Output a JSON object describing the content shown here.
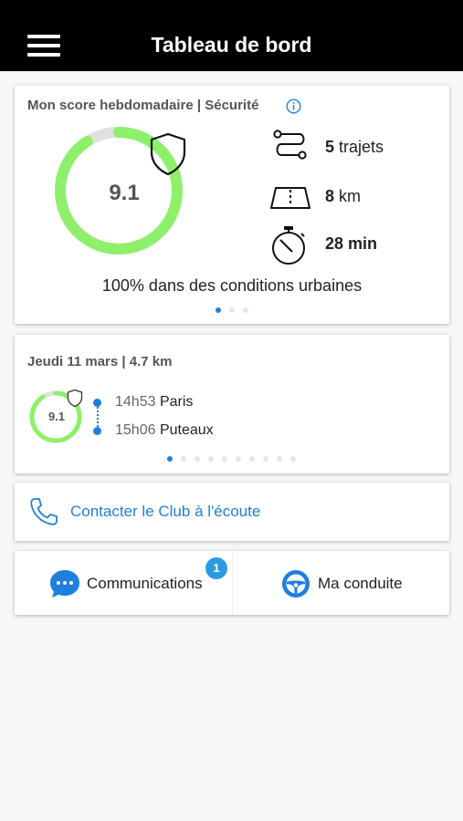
{
  "header": {
    "title": "Tableau de bord",
    "menu_icon": "hamburger-menu-icon"
  },
  "weekly_score": {
    "heading": "Mon score hebdomadaire | Sécurité",
    "score": "9.1",
    "score_fraction": 0.91,
    "stats": {
      "trips_value": "5",
      "trips_unit": "trajets",
      "distance_value": "8",
      "distance_unit": "km",
      "duration": "28 min"
    },
    "urban_text": "100% dans des conditions urbaines",
    "pager": {
      "count": 3,
      "active": 0
    }
  },
  "last_trip": {
    "heading": "Jeudi 11 mars | 4.7 km",
    "score": "9.1",
    "score_fraction": 0.91,
    "departure_time": "14h53",
    "departure_place": "Paris",
    "arrival_time": "15h06",
    "arrival_place": "Puteaux",
    "pager": {
      "count": 10,
      "active": 0
    }
  },
  "contact": {
    "label": "Contacter le Club à l'écoute"
  },
  "actions": {
    "communications_label": "Communications",
    "communications_badge": "1",
    "driving_label": "Ma conduite"
  },
  "colors": {
    "header_bg": "#000000",
    "accent_blue": "#1e7fe0",
    "gauge_green": "#8ef06a",
    "gauge_track": "#e0e0e0",
    "badge_blue": "#2a9be0"
  }
}
